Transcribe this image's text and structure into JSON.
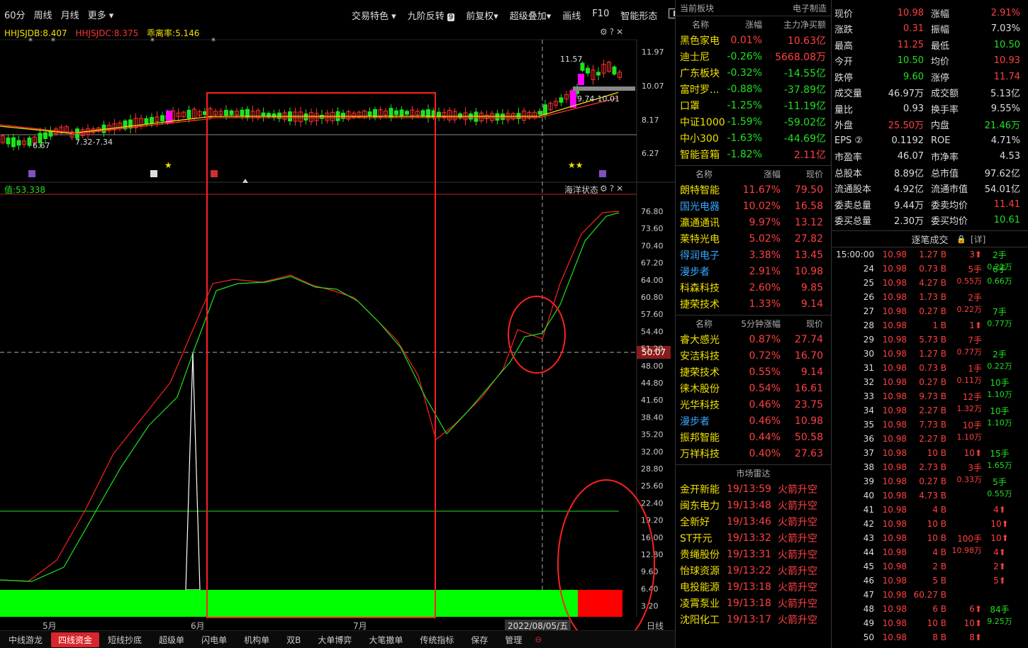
{
  "toolbar": {
    "left": [
      "60分",
      "周线",
      "月线",
      "更多"
    ],
    "right": [
      "交易特色",
      "九阶反转",
      "前复权",
      "超级叠加",
      "画线",
      "F10",
      "智能形态"
    ],
    "badge": "9"
  },
  "legend": {
    "hhjsjdb": "HHJSJDB:8.407",
    "hhjsjdc": "HHJSJDC:8.375",
    "deviation": "乖离率:5.146"
  },
  "price_axis": [
    "11.97",
    "10.07",
    "8.17",
    "6.27"
  ],
  "price_annotations": {
    "high": "11.57",
    "low": "6.67",
    "range1": "7.32-7.34",
    "range2": "9.74-10.01"
  },
  "indicator": {
    "value_label": "值:53.338",
    "title": "海洋状态",
    "cursor_value": "50.07"
  },
  "indicator_axis": [
    "76.80",
    "73.60",
    "70.40",
    "67.20",
    "64.00",
    "60.80",
    "57.60",
    "54.40",
    "51.20",
    "48.00",
    "44.80",
    "41.60",
    "38.40",
    "35.20",
    "32.00",
    "28.80",
    "25.60",
    "22.40",
    "19.20",
    "16.00",
    "12.80",
    "9.60",
    "6.40",
    "3.20"
  ],
  "dates": {
    "may": "5月",
    "jun": "6月",
    "jul": "7月",
    "cursor": "2022/08/05/五",
    "period": "日线"
  },
  "bottom_tabs": [
    "中线游龙",
    "四线资金",
    "短线抄底",
    "超级单",
    "闪电单",
    "机构单",
    "双B",
    "大单博弈",
    "大笔撤单",
    "传统指标",
    "保存",
    "管理"
  ],
  "sector": {
    "header_left": "当前板块",
    "header_right": "电子制造",
    "cols": [
      "名称",
      "涨幅",
      "主力净买额"
    ],
    "rows": [
      {
        "name": "黑色家电",
        "pct": "0.01%",
        "val": "10.63亿",
        "c": "red"
      },
      {
        "name": "迪士尼",
        "pct": "-0.26%",
        "val": "5668.08万",
        "c": "green"
      },
      {
        "name": "广东板块",
        "pct": "-0.32%",
        "val": "-14.55亿",
        "c": "green"
      },
      {
        "name": "富时罗...",
        "pct": "-0.88%",
        "val": "-37.89亿",
        "c": "green"
      },
      {
        "name": "口罩",
        "pct": "-1.25%",
        "val": "-11.19亿",
        "c": "green"
      },
      {
        "name": "中证1000",
        "pct": "-1.59%",
        "val": "-59.02亿",
        "c": "green"
      },
      {
        "name": "中小300",
        "pct": "-1.63%",
        "val": "-44.69亿",
        "c": "green"
      },
      {
        "name": "智能音箱",
        "pct": "-1.82%",
        "val": "2.11亿",
        "c": "green"
      }
    ]
  },
  "stocks": {
    "cols": [
      "名称",
      "涨幅",
      "现价"
    ],
    "rows": [
      {
        "name": "朗特智能",
        "pct": "11.67%",
        "price": "79.50",
        "nc": "yellow"
      },
      {
        "name": "国光电器",
        "pct": "10.02%",
        "price": "16.58",
        "nc": "blue"
      },
      {
        "name": "瀛通通讯",
        "pct": "9.97%",
        "price": "13.12",
        "nc": "yellow"
      },
      {
        "name": "莱特光电",
        "pct": "5.02%",
        "price": "27.82",
        "nc": "yellow"
      },
      {
        "name": "得润电子",
        "pct": "3.38%",
        "price": "13.45",
        "nc": "blue"
      },
      {
        "name": "漫步者",
        "pct": "2.91%",
        "price": "10.98",
        "nc": "blue"
      },
      {
        "name": "科森科技",
        "pct": "2.60%",
        "price": "9.85",
        "nc": "yellow"
      },
      {
        "name": "捷荣技术",
        "pct": "1.33%",
        "price": "9.14",
        "nc": "yellow"
      }
    ]
  },
  "five_min": {
    "cols": [
      "名称",
      "5分钟涨幅",
      "现价"
    ],
    "rows": [
      {
        "name": "睿大感光",
        "pct": "0.87%",
        "price": "27.74",
        "nc": "yellow"
      },
      {
        "name": "安洁科技",
        "pct": "0.72%",
        "price": "16.70",
        "nc": "yellow"
      },
      {
        "name": "捷荣技术",
        "pct": "0.55%",
        "price": "9.14",
        "nc": "yellow"
      },
      {
        "name": "徕木股份",
        "pct": "0.54%",
        "price": "16.61",
        "nc": "yellow"
      },
      {
        "name": "光华科技",
        "pct": "0.46%",
        "price": "23.75",
        "nc": "yellow"
      },
      {
        "name": "漫步者",
        "pct": "0.46%",
        "price": "10.98",
        "nc": "blue"
      },
      {
        "name": "振邦智能",
        "pct": "0.44%",
        "price": "50.58",
        "nc": "yellow"
      },
      {
        "name": "万祥科技",
        "pct": "0.40%",
        "price": "27.63",
        "nc": "yellow"
      }
    ]
  },
  "radar": {
    "title": "市场雷达",
    "rows": [
      {
        "name": "金开新能",
        "time": "19/13:59",
        "event": "火箭升空"
      },
      {
        "name": "闽东电力",
        "time": "19/13:48",
        "event": "火箭升空"
      },
      {
        "name": "全新好",
        "time": "19/13:46",
        "event": "火箭升空"
      },
      {
        "name": "ST开元",
        "time": "19/13:32",
        "event": "火箭升空"
      },
      {
        "name": "贵绳股份",
        "time": "19/13:31",
        "event": "火箭升空"
      },
      {
        "name": "怡球资源",
        "time": "19/13:22",
        "event": "火箭升空"
      },
      {
        "name": "电投能源",
        "time": "19/13:18",
        "event": "火箭升空"
      },
      {
        "name": "凌霄泵业",
        "time": "19/13:18",
        "event": "火箭升空"
      },
      {
        "name": "沈阳化工",
        "time": "19/13:17",
        "event": "火箭升空"
      }
    ]
  },
  "quote": {
    "rows": [
      [
        {
          "k": "现价",
          "v": "10.98",
          "c": "red"
        },
        {
          "k": "涨幅",
          "v": "2.91%",
          "c": "red"
        }
      ],
      [
        {
          "k": "涨跌",
          "v": "0.31",
          "c": "red"
        },
        {
          "k": "振幅",
          "v": "7.03%",
          "c": "white"
        }
      ],
      [
        {
          "k": "最高",
          "v": "11.25",
          "c": "red"
        },
        {
          "k": "最低",
          "v": "10.50",
          "c": "green"
        }
      ],
      [
        {
          "k": "今开",
          "v": "10.50",
          "c": "green"
        },
        {
          "k": "均价",
          "v": "10.93",
          "c": "red"
        }
      ],
      [
        {
          "k": "跌停",
          "v": "9.60",
          "c": "green"
        },
        {
          "k": "涨停",
          "v": "11.74",
          "c": "red"
        }
      ],
      [
        {
          "k": "成交量",
          "v": "46.97万",
          "c": "white"
        },
        {
          "k": "成交额",
          "v": "5.13亿",
          "c": "white"
        }
      ],
      [
        {
          "k": "量比",
          "v": "0.93",
          "c": "white"
        },
        {
          "k": "换手率",
          "v": "9.55%",
          "c": "white"
        }
      ],
      [
        {
          "k": "外盘",
          "v": "25.50万",
          "c": "red"
        },
        {
          "k": "内盘",
          "v": "21.46万",
          "c": "green"
        }
      ],
      [
        {
          "k": "EPS ②",
          "v": "0.1192",
          "c": "white"
        },
        {
          "k": "ROE",
          "v": "4.71%",
          "c": "white"
        }
      ],
      [
        {
          "k": "市盈率",
          "v": "46.07",
          "c": "white"
        },
        {
          "k": "市净率",
          "v": "4.53",
          "c": "white"
        }
      ],
      [
        {
          "k": "总股本",
          "v": "8.89亿",
          "c": "white"
        },
        {
          "k": "总市值",
          "v": "97.62亿",
          "c": "white"
        }
      ],
      [
        {
          "k": "流通股本",
          "v": "4.92亿",
          "c": "white"
        },
        {
          "k": "流通市值",
          "v": "54.01亿",
          "c": "white"
        }
      ],
      [
        {
          "k": "委卖总量",
          "v": "9.44万",
          "c": "white"
        },
        {
          "k": "委卖均价",
          "v": "11.41",
          "c": "red"
        }
      ],
      [
        {
          "k": "委买总量",
          "v": "2.30万",
          "c": "white"
        },
        {
          "k": "委买均价",
          "v": "10.61",
          "c": "green"
        }
      ]
    ]
  },
  "ticks": {
    "title": "逐笔成交",
    "detail": "[详]",
    "rows": [
      {
        "t": "15:00:00",
        "p": "10.98",
        "v": "1.27 B",
        "n": "3",
        "up": true,
        "box": [
          "2手",
          "0.22万"
        ]
      },
      {
        "t": "24",
        "p": "10.98",
        "v": "0.73 B",
        "n": "5手",
        "up": false,
        "box": [
          "6手",
          "0.66万"
        ],
        "sub": "0.55万"
      },
      {
        "t": "25",
        "p": "10.98",
        "v": "4.27 B",
        "n": "",
        "up": false
      },
      {
        "t": "26",
        "p": "10.98",
        "v": "1.73 B",
        "n": "2手",
        "up": false,
        "sub": "0.22万"
      },
      {
        "t": "27",
        "p": "10.98",
        "v": "0.27 B",
        "n": "",
        "up": false,
        "box": [
          "7手",
          "0.77万"
        ]
      },
      {
        "t": "28",
        "p": "10.98",
        "v": "1 B",
        "n": "1",
        "up": true
      },
      {
        "t": "29",
        "p": "10.98",
        "v": "5.73 B",
        "n": "7手",
        "up": false,
        "sub": "0.77万"
      },
      {
        "t": "30",
        "p": "10.98",
        "v": "1.27 B",
        "n": "",
        "up": false,
        "box": [
          "2手",
          "0.22万"
        ]
      },
      {
        "t": "31",
        "p": "10.98",
        "v": "0.73 B",
        "n": "1手",
        "up": false,
        "sub": "0.11万"
      },
      {
        "t": "32",
        "p": "10.98",
        "v": "0.27 B",
        "n": "",
        "up": false,
        "box": [
          "10手",
          "1.10万"
        ]
      },
      {
        "t": "33",
        "p": "10.98",
        "v": "9.73 B",
        "n": "12手",
        "up": false,
        "sub": "1.32万"
      },
      {
        "t": "34",
        "p": "10.98",
        "v": "2.27 B",
        "n": "",
        "up": false,
        "box": [
          "10手",
          "1.10万"
        ]
      },
      {
        "t": "35",
        "p": "10.98",
        "v": "7.73 B",
        "n": "10手",
        "up": false,
        "sub": "1.10万"
      },
      {
        "t": "36",
        "p": "10.98",
        "v": "2.27 B",
        "n": "",
        "up": false
      },
      {
        "t": "37",
        "p": "10.98",
        "v": "10 B",
        "n": "10",
        "up": true,
        "box": [
          "15手",
          "1.65万"
        ]
      },
      {
        "t": "38",
        "p": "10.98",
        "v": "2.73 B",
        "n": "3手",
        "up": false,
        "sub": "0.33万"
      },
      {
        "t": "39",
        "p": "10.98",
        "v": "0.27 B",
        "n": "",
        "up": false,
        "box": [
          "5手",
          "0.55万"
        ]
      },
      {
        "t": "40",
        "p": "10.98",
        "v": "4.73 B",
        "n": "",
        "up": false
      },
      {
        "t": "41",
        "p": "10.98",
        "v": "4 B",
        "n": "",
        "up": false,
        "right": "4"
      },
      {
        "t": "42",
        "p": "10.98",
        "v": "10 B",
        "n": "",
        "up": false,
        "right": "10"
      },
      {
        "t": "43",
        "p": "10.98",
        "v": "10 B",
        "n": "100手",
        "up": false,
        "sub": "10.98万",
        "right": "10"
      },
      {
        "t": "44",
        "p": "10.98",
        "v": "4 B",
        "n": "",
        "up": false,
        "right": "4"
      },
      {
        "t": "45",
        "p": "10.98",
        "v": "2 B",
        "n": "",
        "up": false,
        "right": "2"
      },
      {
        "t": "46",
        "p": "10.98",
        "v": "5 B",
        "n": "",
        "up": false,
        "right": "5"
      },
      {
        "t": "47",
        "p": "10.98",
        "v": "60.27 B",
        "n": "",
        "up": false
      },
      {
        "t": "48",
        "p": "10.98",
        "v": "6 B",
        "n": "6",
        "up": true,
        "box": [
          "84手",
          "9.25万"
        ]
      },
      {
        "t": "49",
        "p": "10.98",
        "v": "10 B",
        "n": "10",
        "up": true
      },
      {
        "t": "50",
        "p": "10.98",
        "v": "8 B",
        "n": "8",
        "up": true
      }
    ]
  },
  "colors": {
    "up": "#ff3030",
    "down": "#1ee21e",
    "bg": "#000000",
    "accent": "#d8262c"
  }
}
